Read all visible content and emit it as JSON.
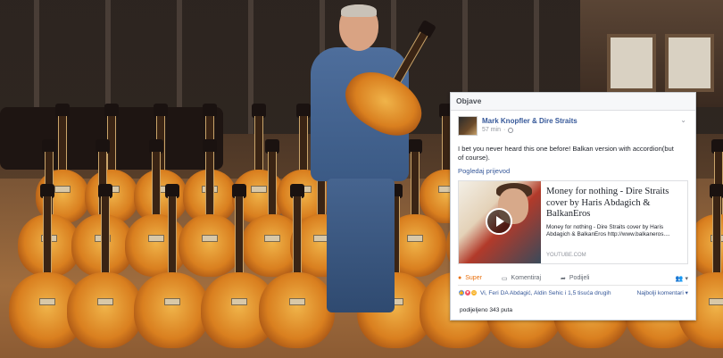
{
  "panel": {
    "header_title": "Objave"
  },
  "post": {
    "author": "Mark Knopfler & Dire Straits",
    "time": "57 min",
    "text": "I bet you never heard this one before! Balkan version with accordion(but of course).",
    "translate_link": "Pogledaj prijevod",
    "menu_icon": "chevron-down-icon"
  },
  "link_preview": {
    "title": "Money for nothing - Dire Straits cover by Haris Abdagich & BalkanEros",
    "description": "Money for nothing - Dire Straits cover by Haris Abdagich & BalkanEros http://www.balkaneros....",
    "domain": "YOUTUBE.COM",
    "play_icon": "play-icon"
  },
  "actions": {
    "like": "Super",
    "comment": "Komentiraj",
    "share": "Podijeli"
  },
  "reactions": {
    "summary": "Vi, Feri DA Abdagić, Aldin Sehic i 1,5 tisuća drugih",
    "sort": "Najbolji komentari"
  },
  "shares": {
    "text": "podijeljeno 343 puta"
  },
  "colors": {
    "link_blue": "#365899",
    "like_orange": "#e9710f",
    "guitar_sunburst": "#d97f1f"
  }
}
